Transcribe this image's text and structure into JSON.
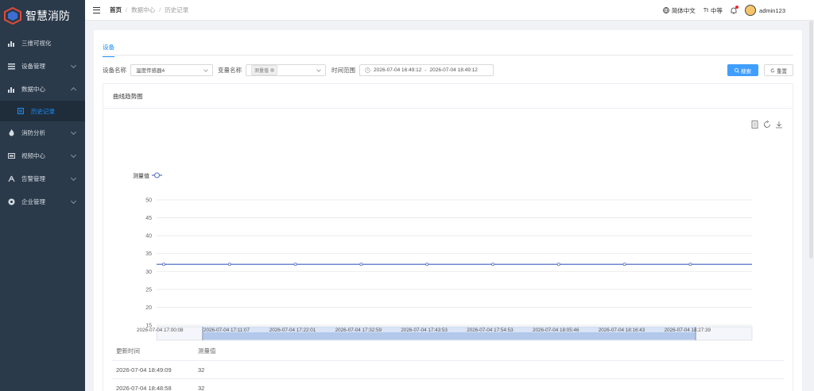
{
  "app": {
    "title": "智慧消防"
  },
  "sidebar": {
    "items": [
      {
        "label": "三维可视化",
        "icon": "chart-icon",
        "has_children": false
      },
      {
        "label": "设备管理",
        "icon": "list-icon",
        "has_children": true
      },
      {
        "label": "数据中心",
        "icon": "chart-icon",
        "has_children": true,
        "expanded": true
      },
      {
        "label": "消防分析",
        "icon": "fire-icon",
        "has_children": true
      },
      {
        "label": "视频中心",
        "icon": "video-icon",
        "has_children": true
      },
      {
        "label": "告警管理",
        "icon": "alarm-icon",
        "has_children": true
      },
      {
        "label": "企业管理",
        "icon": "company-icon",
        "has_children": true
      }
    ],
    "active_sub": "历史记录"
  },
  "topbar": {
    "breadcrumb": [
      "首页",
      "数据中心",
      "历史记录"
    ],
    "lang": "简体中文",
    "font_size": "中等",
    "username": "admin123"
  },
  "tabs": {
    "active": "设备"
  },
  "filters": {
    "device_label": "设备名称",
    "device_value": "温度传感器4",
    "variable_label": "变量名称",
    "variable_tag": "测量值",
    "time_label": "时间范围",
    "time_start": "2026-07-04 16:49:12",
    "time_sep": "-",
    "time_end": "2026-07-04 18:49:12",
    "search_label": "搜索",
    "reset_label": "重置"
  },
  "card": {
    "title": "曲线趋势图"
  },
  "chart_data": {
    "type": "line",
    "legend": [
      "测量值"
    ],
    "y_ticks": [
      15,
      20,
      25,
      30,
      35,
      40,
      45,
      50
    ],
    "ylim": [
      15,
      50
    ],
    "x_labels": [
      "2026-07-04 17:00:08",
      "2026-07-04 17:11:07",
      "2026-07-04 17:22:01",
      "2026-07-04 17:32:59",
      "2026-07-04 17:43:53",
      "2026-07-04 17:54:53",
      "2026-07-04 18:05:46",
      "2026-07-04 18:16:43",
      "2026-07-04 18:27:39"
    ],
    "series": [
      {
        "name": "测量值",
        "values": [
          32,
          32,
          32,
          32,
          32,
          32,
          32,
          32,
          32
        ]
      }
    ],
    "line_color": "#5470c6"
  },
  "table": {
    "headers": [
      "更新时间",
      "测量值"
    ],
    "rows": [
      [
        "2026-07-04 18:49:09",
        "32"
      ],
      [
        "2026-07-04 18:48:58",
        "32"
      ]
    ]
  }
}
